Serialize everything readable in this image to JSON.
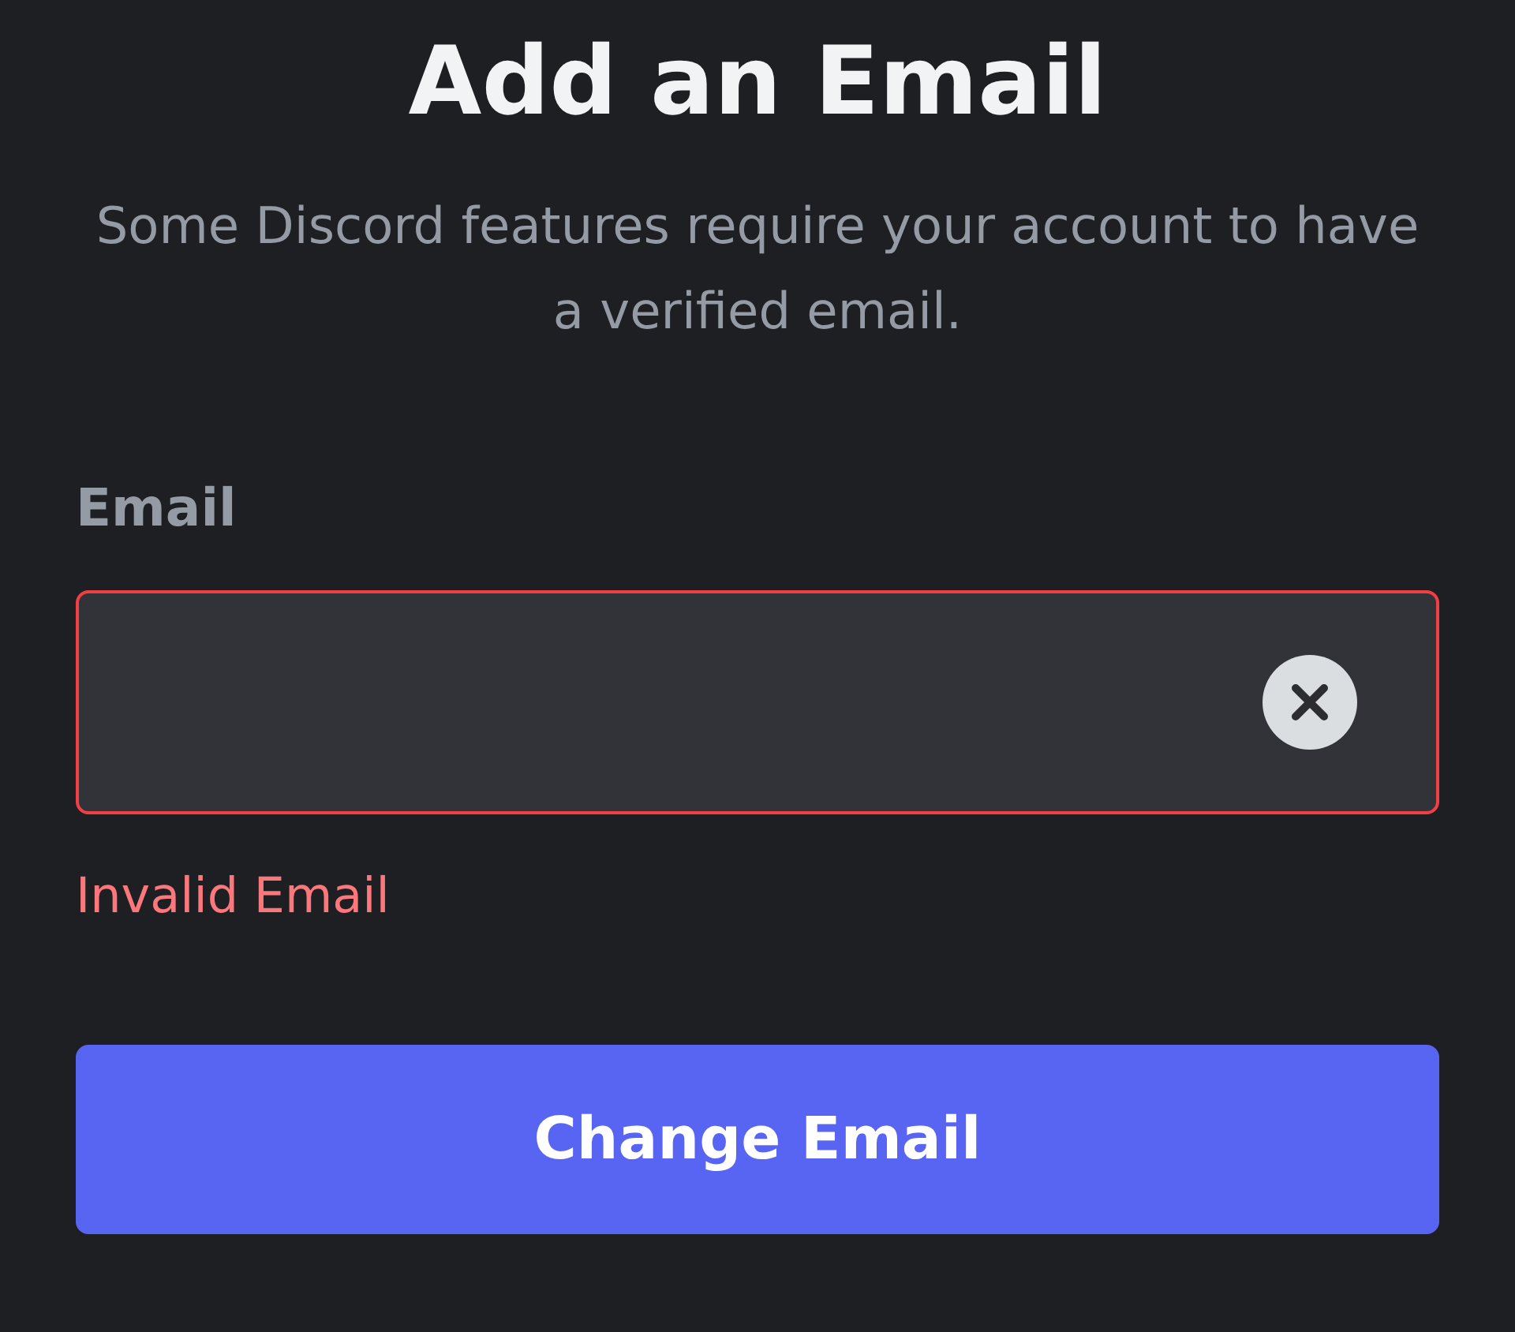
{
  "title": "Add an Email",
  "subtitle": "Some Discord features require your account to have a verified email.",
  "email_field": {
    "label": "Email",
    "invalid": true,
    "error": "Invalid Email"
  },
  "submit_button": {
    "label": "Change Email"
  }
}
